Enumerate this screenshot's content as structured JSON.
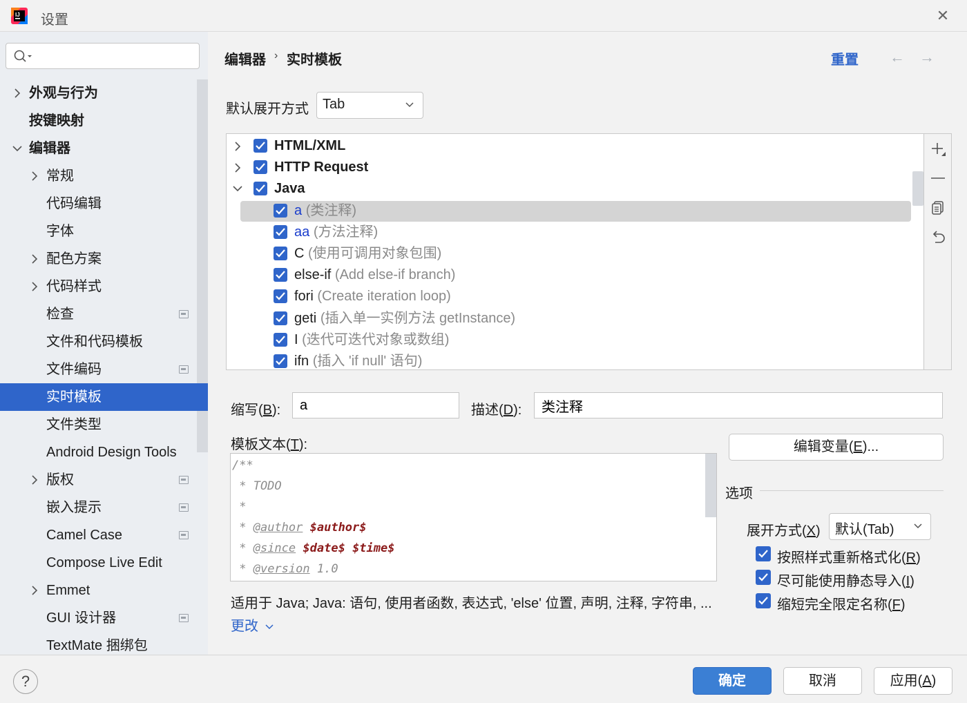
{
  "window": {
    "title": "设置"
  },
  "search": {
    "placeholder": ""
  },
  "sidebar": {
    "items": [
      {
        "label": "外观与行为",
        "bold": true,
        "chevron": "right"
      },
      {
        "label": "按键映射",
        "bold": true,
        "chevron": ""
      },
      {
        "label": "编辑器",
        "bold": true,
        "chevron": "down"
      },
      {
        "label": "常规",
        "chevron": "right"
      },
      {
        "label": "代码编辑",
        "chevron": ""
      },
      {
        "label": "字体",
        "chevron": ""
      },
      {
        "label": "配色方案",
        "chevron": "right"
      },
      {
        "label": "代码样式",
        "chevron": "right"
      },
      {
        "label": "检查",
        "chevron": "",
        "project": true
      },
      {
        "label": "文件和代码模板",
        "chevron": ""
      },
      {
        "label": "文件编码",
        "chevron": "",
        "project": true
      },
      {
        "label": "实时模板",
        "chevron": "",
        "selected": true
      },
      {
        "label": "文件类型",
        "chevron": ""
      },
      {
        "label": "Android Design Tools",
        "chevron": ""
      },
      {
        "label": "版权",
        "chevron": "right",
        "project": true
      },
      {
        "label": "嵌入提示",
        "chevron": "",
        "project": true
      },
      {
        "label": "Camel Case",
        "chevron": "",
        "project": true
      },
      {
        "label": "Compose Live Edit",
        "chevron": ""
      },
      {
        "label": "Emmet",
        "chevron": "right"
      },
      {
        "label": "GUI 设计器",
        "chevron": "",
        "project": true
      },
      {
        "label": "TextMate 捆绑包",
        "chevron": ""
      }
    ]
  },
  "header": {
    "breadcrumb_1": "编辑器",
    "breadcrumb_sep": "›",
    "breadcrumb_2": "实时模板",
    "reset": "重置",
    "back": "←",
    "forward": "→"
  },
  "expand_default": {
    "label": "默认展开方式",
    "value": "Tab"
  },
  "templates": [
    {
      "name": "HTML/XML",
      "group": true,
      "chevron": "right",
      "checked": true
    },
    {
      "name": "HTTP Request",
      "group": true,
      "chevron": "right",
      "checked": true
    },
    {
      "name": "Java",
      "group": true,
      "chevron": "down",
      "checked": true
    },
    {
      "name": "a",
      "desc": "(类注释)",
      "checked": true,
      "selected": true,
      "blue": true
    },
    {
      "name": "aa",
      "desc": "(方法注释)",
      "checked": true,
      "blue": true
    },
    {
      "name": "C",
      "desc": "(使用可调用对象包围)",
      "checked": true
    },
    {
      "name": "else-if",
      "desc": "(Add else-if branch)",
      "checked": true
    },
    {
      "name": "fori",
      "desc": "(Create iteration loop)",
      "checked": true
    },
    {
      "name": "geti",
      "desc": "(插入单一实例方法 getInstance)",
      "checked": true
    },
    {
      "name": "I",
      "desc": "(迭代可迭代对象或数组)",
      "checked": true
    },
    {
      "name": "ifn",
      "desc": "(插入 'if null' 语句)",
      "checked": true
    }
  ],
  "form": {
    "abbr_label": "缩写(",
    "abbr_key": "B",
    "abbr_end": "):",
    "abbr_value": "a",
    "desc_label": "描述(",
    "desc_key": "D",
    "desc_end": "):",
    "desc_value": "类注释",
    "template_label": "模板文本(",
    "template_key": "T",
    "template_end": "):",
    "edit_vars_label": "编辑变量(",
    "edit_vars_key": "E",
    "edit_vars_end": ")..."
  },
  "template_text": {
    "l1": "/**",
    "l2": " * TODO",
    "l3": " *",
    "l4_pre": " * ",
    "l4_tag": "@author",
    "l4_var": "$author$",
    "l5_pre": " * ",
    "l5_tag": "@since",
    "l5_var1": "$date$",
    "l5_var2": "$time$",
    "l6_pre": " * ",
    "l6_tag": "@version",
    "l6_val": "1.0"
  },
  "options": {
    "title": "选项",
    "expand_label": "展开方式(",
    "expand_key": "X",
    "expand_end": ")",
    "expand_value": "默认(Tab)",
    "reformat": {
      "label": "按照样式重新格式化(",
      "key": "R",
      "end": ")",
      "checked": true
    },
    "static_import": {
      "label": "尽可能使用静态导入(",
      "key": "I",
      "end": ")",
      "checked": true
    },
    "shorten_fq": {
      "label": "缩短完全限定名称(",
      "key": "F",
      "end": ")",
      "checked": true
    }
  },
  "applies_to": "适用于 Java; Java: 语句, 使用者函数, 表达式, 'else' 位置, 声明, 注释, 字符串, ...",
  "change_link": "更改",
  "footer": {
    "help": "?",
    "ok": "确定",
    "cancel": "取消",
    "apply_label": "应用(",
    "apply_key": "A",
    "apply_end": ")"
  },
  "colors": {
    "accent": "#2f65ca",
    "selection": "#d4d4d4",
    "sidebar_bg": "#ebeef2",
    "primary_button": "#3b7fd4"
  }
}
